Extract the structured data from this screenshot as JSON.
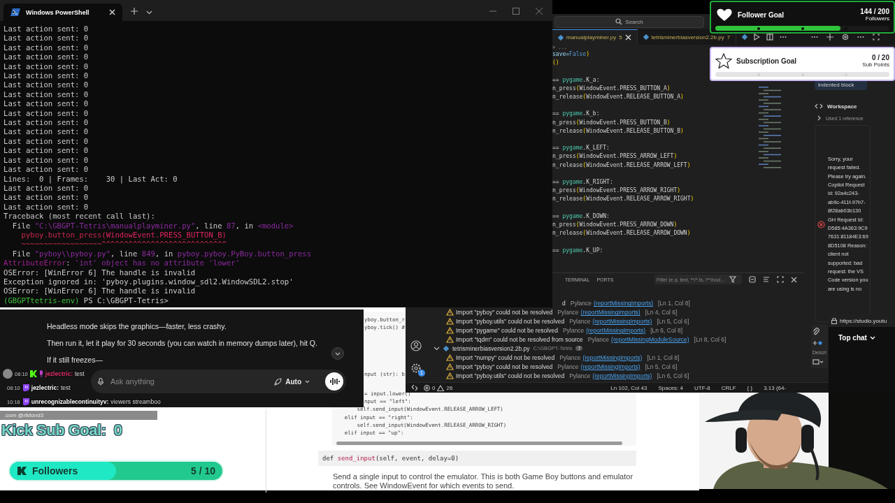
{
  "terminal": {
    "title": "Windows PowerShell",
    "lines": [
      {
        "segments": [
          {
            "text": "Last action sent: 0",
            "kind": "plain"
          }
        ]
      },
      {
        "segments": [
          {
            "text": "Last action sent: 0",
            "kind": "plain"
          }
        ]
      },
      {
        "segments": [
          {
            "text": "Last action sent: 0",
            "kind": "plain"
          }
        ]
      },
      {
        "segments": [
          {
            "text": "Last action sent: 0",
            "kind": "plain"
          }
        ]
      },
      {
        "segments": [
          {
            "text": "Last action sent: 0",
            "kind": "plain"
          }
        ]
      },
      {
        "segments": [
          {
            "text": "Last action sent: 0",
            "kind": "plain"
          }
        ]
      },
      {
        "segments": [
          {
            "text": "Last action sent: 0",
            "kind": "plain"
          }
        ]
      },
      {
        "segments": [
          {
            "text": "Last action sent: 0",
            "kind": "plain"
          }
        ]
      },
      {
        "segments": [
          {
            "text": "Last action sent: 0",
            "kind": "plain"
          }
        ]
      },
      {
        "segments": [
          {
            "text": "Last action sent: 0",
            "kind": "plain"
          }
        ]
      },
      {
        "segments": [
          {
            "text": "Last action sent: 0",
            "kind": "plain"
          }
        ]
      },
      {
        "segments": [
          {
            "text": "Last action sent: 0",
            "kind": "plain"
          }
        ]
      },
      {
        "segments": [
          {
            "text": "Last action sent: 0",
            "kind": "plain"
          }
        ]
      },
      {
        "segments": [
          {
            "text": "Last action sent: 0",
            "kind": "plain"
          }
        ]
      },
      {
        "segments": [
          {
            "text": "Last action sent: 0",
            "kind": "plain"
          }
        ]
      },
      {
        "segments": [
          {
            "text": "Last action sent: 0",
            "kind": "plain"
          }
        ]
      },
      {
        "segments": [
          {
            "text": "Lines:  0 | Frames:    30 | Last Act: 0",
            "kind": "plain"
          }
        ]
      },
      {
        "segments": [
          {
            "text": "Last action sent: 0",
            "kind": "plain"
          }
        ]
      },
      {
        "segments": [
          {
            "text": "Last action sent: 0",
            "kind": "plain"
          }
        ]
      },
      {
        "segments": [
          {
            "text": "Last action sent: 0",
            "kind": "plain"
          }
        ]
      },
      {
        "segments": [
          {
            "text": "Traceback (most recent call last):",
            "kind": "plain"
          }
        ]
      },
      {
        "segments": [
          {
            "text": "  File ",
            "kind": "plain"
          },
          {
            "text": "\"C:\\GBGPT-Tetris\\manualplayminer.py\"",
            "kind": "accent"
          },
          {
            "text": ", line ",
            "kind": "plain"
          },
          {
            "text": "87",
            "kind": "accent"
          },
          {
            "text": ", in ",
            "kind": "plain"
          },
          {
            "text": "<module>",
            "kind": "accent"
          }
        ]
      },
      {
        "segments": [
          {
            "text": "    pyboy.button_press",
            "kind": "error"
          },
          {
            "text": "(WindowEvent.PRESS_BUTTON_B)",
            "kind": "highlight"
          }
        ]
      },
      {
        "segments": [
          {
            "text": "    ~~~~~~~~~~~~~~~~~~^^^^^^^^^^^^^^^^^^^^^^^^^^^^",
            "kind": "error"
          }
        ]
      },
      {
        "segments": [
          {
            "text": "  File ",
            "kind": "plain"
          },
          {
            "text": "\"pyboy\\\\pyboy.py\"",
            "kind": "accent"
          },
          {
            "text": ", line ",
            "kind": "plain"
          },
          {
            "text": "849",
            "kind": "accent"
          },
          {
            "text": ", in ",
            "kind": "plain"
          },
          {
            "text": "pyboy.pyboy.PyBoy.button_press",
            "kind": "accent"
          }
        ]
      },
      {
        "segments": [
          {
            "text": "AttributeError",
            "kind": "errname"
          },
          {
            "text": ": ",
            "kind": "plain"
          },
          {
            "text": "'int' object has no attribute 'lower'",
            "kind": "accent"
          }
        ]
      },
      {
        "segments": [
          {
            "text": "OSError: [WinError 6] The handle is invalid",
            "kind": "plain"
          }
        ]
      },
      {
        "segments": [
          {
            "text": "Exception ignored in: 'pyboy.plugins.window_sdl2.WindowSDL2.stop'",
            "kind": "plain"
          }
        ]
      },
      {
        "segments": [
          {
            "text": "OSError: [WinError 6] The handle is invalid",
            "kind": "plain"
          }
        ]
      },
      {
        "segments": [
          {
            "text": "(GBGPTtetris-env)",
            "kind": "prompt"
          },
          {
            "text": " PS C:\\GBGPT-Tetris>",
            "kind": "plain"
          }
        ]
      }
    ]
  },
  "vscode": {
    "search": {
      "placeholder": "Search"
    },
    "tabs": [
      {
        "label": "manualplayminer.py",
        "badge": "5",
        "selected": true
      },
      {
        "label": "tetrisminerbiasversion2.2b.py",
        "badge": "7",
        "selected": false
      }
    ],
    "breadcrumb": "> ...",
    "code_blocks": [
      [
        [
          {
            "text": "save=",
            "kind": "var"
          },
          {
            "text": "False",
            "kind": "keyword"
          },
          {
            "text": ")",
            "kind": "paren"
          }
        ],
        [
          {
            "text": "()",
            "kind": "paren"
          }
        ]
      ],
      [
        [
          {
            "text": "== ",
            "kind": "plain"
          },
          {
            "text": "pygame",
            "kind": "module"
          },
          {
            "text": ".K_a:",
            "kind": "plain"
          }
        ],
        [
          {
            "text": "n_press",
            "kind": "func"
          },
          {
            "text": "(",
            "kind": "paren"
          },
          {
            "text": "WindowEvent.PRESS_BUTTON_A",
            "kind": "plain"
          },
          {
            "text": ")",
            "kind": "paren"
          }
        ],
        [
          {
            "text": "n_release",
            "kind": "func"
          },
          {
            "text": "(",
            "kind": "paren"
          },
          {
            "text": "WindowEvent.RELEASE_BUTTON_A",
            "kind": "plain"
          },
          {
            "text": ")",
            "kind": "paren"
          }
        ]
      ],
      [
        [
          {
            "text": "== ",
            "kind": "plain"
          },
          {
            "text": "pygame",
            "kind": "module"
          },
          {
            "text": ".K_b:",
            "kind": "plain"
          }
        ],
        [
          {
            "text": "n_press",
            "kind": "func"
          },
          {
            "text": "(",
            "kind": "paren"
          },
          {
            "text": "WindowEvent.PRESS_BUTTON_B",
            "kind": "plain"
          },
          {
            "text": ")",
            "kind": "paren"
          }
        ],
        [
          {
            "text": "n_release",
            "kind": "func"
          },
          {
            "text": "(",
            "kind": "paren"
          },
          {
            "text": "WindowEvent.RELEASE_BUTTON_B",
            "kind": "plain"
          },
          {
            "text": ")",
            "kind": "paren"
          }
        ]
      ],
      [
        [
          {
            "text": "== ",
            "kind": "plain"
          },
          {
            "text": "pygame",
            "kind": "module"
          },
          {
            "text": ".K_LEFT:",
            "kind": "plain"
          }
        ],
        [
          {
            "text": "n_press",
            "kind": "func"
          },
          {
            "text": "(",
            "kind": "paren"
          },
          {
            "text": "WindowEvent.PRESS_ARROW_LEFT",
            "kind": "plain"
          },
          {
            "text": ")",
            "kind": "paren"
          }
        ],
        [
          {
            "text": "n_release",
            "kind": "func"
          },
          {
            "text": "(",
            "kind": "paren"
          },
          {
            "text": "WindowEvent.RELEASE_ARROW_LEFT",
            "kind": "plain"
          },
          {
            "text": ")",
            "kind": "paren"
          }
        ]
      ],
      [
        [
          {
            "text": "== ",
            "kind": "plain"
          },
          {
            "text": "pygame",
            "kind": "module"
          },
          {
            "text": ".K_RIGHT:",
            "kind": "plain"
          }
        ],
        [
          {
            "text": "n_press",
            "kind": "func"
          },
          {
            "text": "(",
            "kind": "paren"
          },
          {
            "text": "WindowEvent.PRESS_ARROW_RIGHT",
            "kind": "plain"
          },
          {
            "text": ")",
            "kind": "paren"
          }
        ],
        [
          {
            "text": "n_release",
            "kind": "func"
          },
          {
            "text": "(",
            "kind": "paren"
          },
          {
            "text": "WindowEvent.RELEASE_ARROW_RIGHT",
            "kind": "plain"
          },
          {
            "text": ")",
            "kind": "paren"
          }
        ]
      ],
      [
        [
          {
            "text": "== ",
            "kind": "plain"
          },
          {
            "text": "pygame",
            "kind": "module"
          },
          {
            "text": ".K_DOWN:",
            "kind": "plain"
          }
        ],
        [
          {
            "text": "n_press",
            "kind": "func"
          },
          {
            "text": "(",
            "kind": "paren"
          },
          {
            "text": "WindowEvent.PRESS_ARROW_DOWN",
            "kind": "plain"
          },
          {
            "text": ")",
            "kind": "paren"
          }
        ],
        [
          {
            "text": "n_release",
            "kind": "func"
          },
          {
            "text": "(",
            "kind": "paren"
          },
          {
            "text": "WindowEvent.RELEASE_ARROW_DOWN",
            "kind": "plain"
          },
          {
            "text": ")",
            "kind": "paren"
          }
        ]
      ],
      [
        [
          {
            "text": "== ",
            "kind": "plain"
          },
          {
            "text": "pygame",
            "kind": "module"
          },
          {
            "text": ".K_UP:",
            "kind": "plain"
          }
        ]
      ]
    ],
    "problems": {
      "tabs": [
        "TERMINAL",
        "PORTS"
      ],
      "filter_placeholder": "Filter (e.g. text, **/*.ts, !**/nod...",
      "items": [
        {
          "kind": "clipped",
          "message": "d",
          "source": "Pylance",
          "code": "(reportMissingImports)",
          "location": "[Ln 1, Col 8]"
        },
        {
          "kind": "warning",
          "message": "Import \"pyboy\" could not be resolved",
          "source": "Pylance",
          "code": "(reportMissingImports)",
          "location": "[Ln 4, Col 6]"
        },
        {
          "kind": "warning",
          "message": "Import \"pyboy.utils\" could not be resolved",
          "source": "Pylance",
          "code": "(reportMissingImports)",
          "location": "[Ln 5, Col 6]"
        },
        {
          "kind": "warning",
          "message": "Import \"pygame\" could not be resolved",
          "source": "Pylance",
          "code": "(reportMissingImports)",
          "location": "[Ln 6, Col 8]"
        },
        {
          "kind": "warning",
          "message": "Import \"tqdm\" could not be resolved from source",
          "source": "Pylance",
          "code": "(reportMissingModuleSource)",
          "location": "[Ln 8, Col 6]"
        },
        {
          "kind": "file",
          "name": "tetrisminerbiasversion2.2b.py",
          "path": "C:\\GBGPT-Tetris",
          "count": "7",
          "expanded": true
        },
        {
          "kind": "warning",
          "message": "Import \"numpy\" could not be resolved",
          "source": "Pylance",
          "code": "(reportMissingImports)",
          "location": "[Ln 1, Col 8]"
        },
        {
          "kind": "warning",
          "message": "Import \"pyboy\" could not be resolved",
          "source": "Pylance",
          "code": "(reportMissingImports)",
          "location": "[Ln 5, Col 6]"
        },
        {
          "kind": "warning",
          "message": "Import \"pyboy.utils\" could not be resolved",
          "source": "Pylance",
          "code": "(reportMissingImports)",
          "location": "[Ln 6, Col 6]"
        }
      ]
    },
    "accounts_badge": "1",
    "copilot": {
      "bubble": "indented block",
      "workspace": "Workspace",
      "reference": "Used 1 reference",
      "error": "Sorry, your request failed. Please try again. Copilot Request id: 92a4c243-ab9c-411f-97b7-8f28ab03b130 GH Request Id: D585:4A363:9C97631:81184E3:698D5108 Reason: client not supported: bad request: the VS Code version you are using is no",
      "input_label": "Descri"
    },
    "status_bar": {
      "errors": "0",
      "warnings": "26",
      "items": [
        "Ln 102, Col 43",
        "Spaces: 4",
        "UTF-8",
        "CRLF",
        "{ }",
        "3.13 (64-"
      ]
    }
  },
  "chatgpt": {
    "paragraphs": [
      "Headless mode skips the graphics—faster, less crashy.",
      "Then run it, let it play for 30 seconds (you can watch in memory dumps later), hit Q.",
      "If it still freezes—"
    ],
    "input": {
      "placeholder": "Ask anything"
    },
    "mode": "Auto"
  },
  "stream_chat": {
    "messages": [
      {
        "time": "08:10",
        "kind": "kick",
        "avatar": true,
        "mic": true,
        "user": "jezlectric:",
        "color": "#e0306a",
        "text": "test"
      },
      {
        "time": "08:10",
        "kind": "twitch",
        "avatar": false,
        "mic": false,
        "user": "jezlectric:",
        "color": "#ffffff",
        "text": "test"
      },
      {
        "time": "10:16",
        "kind": "twitch",
        "avatar": false,
        "mic": false,
        "user": "unrecognizablecontinuityv:",
        "color": "#ffffff",
        "text": "viewers streamboo"
      }
    ],
    "continuation": ".com @rlkfond3"
  },
  "docs": {
    "code_top": [
      "yboy.button_r",
      "yboy.tick() #"
    ],
    "code_mid": [
      "nput (str): b"
    ],
    "code_bottom": [
      {
        "kind": "clipped",
        "text": "= input.lower()"
      },
      {
        "kind": "clipped",
        "text": "nput == \"left\":"
      },
      {
        "kind": "full",
        "text": "        self.send_input(WindowEvent.RELEASE_ARROW_LEFT)"
      },
      {
        "kind": "full",
        "text": "    elif input == \"right\":"
      },
      {
        "kind": "full",
        "text": "        self.send_input(WindowEvent.RELEASE_ARROW_RIGHT)"
      },
      {
        "kind": "full",
        "text": "    elif input == \"up\":"
      }
    ],
    "signature": [
      {
        "text": "def ",
        "kind": "plain"
      },
      {
        "text": "send_input",
        "kind": "name"
      },
      {
        "text": "(self, event, delay=0)",
        "kind": "plain"
      }
    ],
    "description": "Send a single input to control the emulator. This is both Game Boy buttons and emulator controls. See WindowEvent for which events to send."
  },
  "kick_goal": {
    "label": "Kick Sub Goal:  0"
  },
  "kick_followers": {
    "label": "Followers",
    "count": "5 / 10",
    "level": 0.5
  },
  "follower_goal": {
    "title": "Follower Goal",
    "count": "144 / 200",
    "unit": "Followers",
    "level": 0.72
  },
  "subscription_goal": {
    "title": "Subscription Goal",
    "count": "0 / 20",
    "unit": "Sub Points",
    "level": 0
  },
  "youtube_chat": {
    "url": "https://studio.youtu",
    "title": "Top chat"
  }
}
